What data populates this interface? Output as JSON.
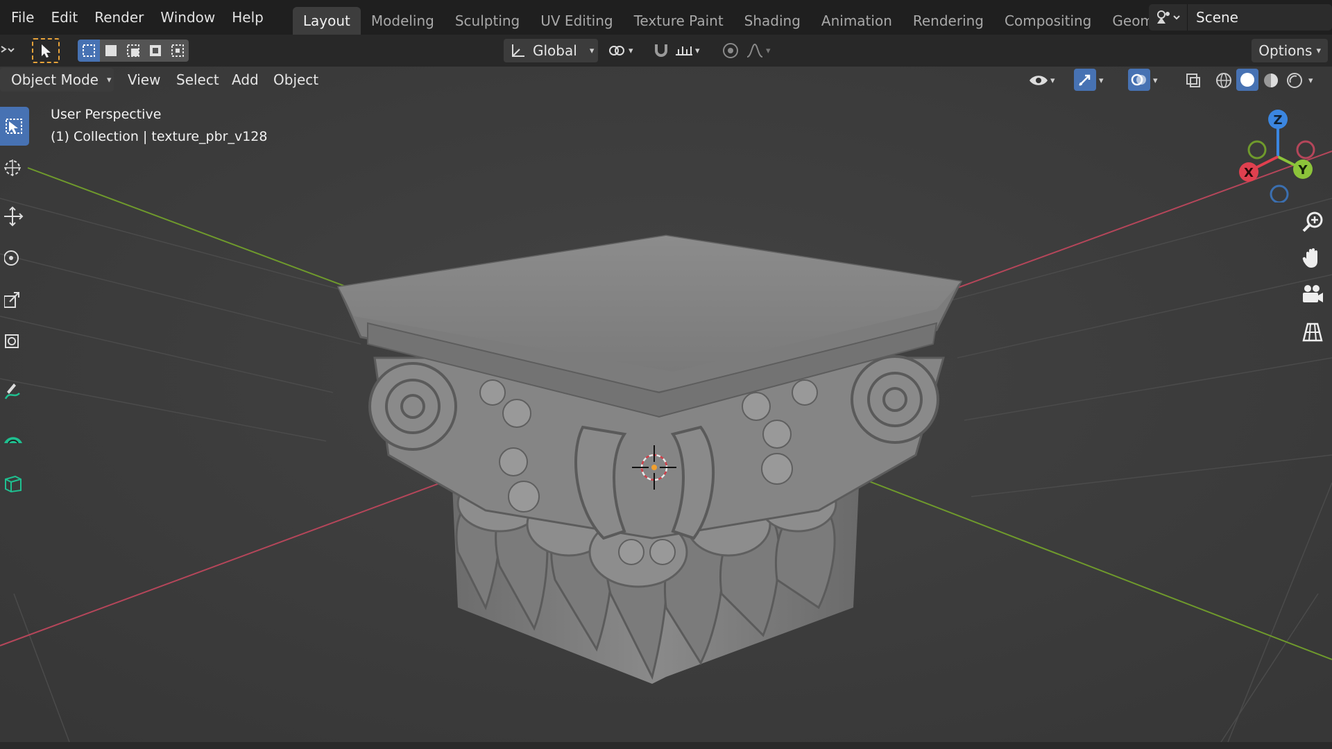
{
  "menu": {
    "file": "File",
    "edit": "Edit",
    "render": "Render",
    "window": "Window",
    "help": "Help"
  },
  "workspaces": [
    {
      "label": "Layout",
      "active": true
    },
    {
      "label": "Modeling"
    },
    {
      "label": "Sculpting"
    },
    {
      "label": "UV Editing"
    },
    {
      "label": "Texture Paint"
    },
    {
      "label": "Shading"
    },
    {
      "label": "Animation"
    },
    {
      "label": "Rendering"
    },
    {
      "label": "Compositing"
    },
    {
      "label": "Geometry Nod"
    }
  ],
  "scene": {
    "label": "Scene",
    "icon": "scene-icon"
  },
  "tool_header": {
    "transform_orientation": "Global",
    "options": "Options"
  },
  "viewport_header": {
    "mode": "Object Mode",
    "view": "View",
    "select": "Select",
    "add": "Add",
    "object": "Object"
  },
  "viewport": {
    "perspective": "User Perspective",
    "collection": "(1) Collection | texture_pbr_v128"
  },
  "gizmo": {
    "z": "Z",
    "y": "Y",
    "x": "X",
    "colors": {
      "x": "#e0404f",
      "y": "#8cc43a",
      "z": "#3b86e0"
    }
  },
  "icons": {
    "select_box": "cursor-select-icon",
    "cursor": "3d-cursor-icon",
    "move": "move-icon",
    "rotate": "rotate-icon",
    "scale": "scale-icon",
    "transform": "transform-icon",
    "annotate": "annotate-icon",
    "measure": "measure-icon",
    "add_cube": "add-cube-icon",
    "zoom": "zoom-icon",
    "pan": "pan-hand-icon",
    "camera": "camera-icon",
    "grid": "ortho-grid-icon"
  },
  "colors": {
    "accent": "#4772b3",
    "x_axis": "#b5465a",
    "y_axis": "#6f9a2c",
    "grid": "#4a4a4a",
    "viewport_bg": "#3d3d3d"
  }
}
